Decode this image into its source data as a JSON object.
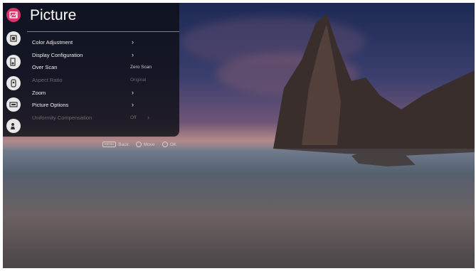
{
  "menu": {
    "title": "Picture",
    "items": [
      {
        "label": "Color Adjustment",
        "value": "",
        "chevron": "›",
        "enabled": true
      },
      {
        "label": "Display Configuration",
        "value": "",
        "chevron": "›",
        "enabled": true
      },
      {
        "label": "Over Scan",
        "value": "Zero Scan",
        "chevron": "",
        "enabled": true
      },
      {
        "label": "Aspect Ratio",
        "value": "Original",
        "chevron": "",
        "enabled": false
      },
      {
        "label": "Zoom",
        "value": "",
        "chevron": "›",
        "enabled": true
      },
      {
        "label": "Picture Options",
        "value": "",
        "chevron": "›",
        "enabled": true
      },
      {
        "label": "Uniformity Compensation",
        "value": "Off",
        "chevron": "›",
        "enabled": false
      }
    ]
  },
  "sidebar": {
    "icons": [
      "picture-icon",
      "display-icon",
      "sound-icon",
      "network-icon",
      "keyboard-icon",
      "admin-icon"
    ],
    "active_color": "#d8336a"
  },
  "footer": {
    "back_key": "MENU",
    "back_label": "Back",
    "move_label": "Move",
    "ok_label": "OK"
  }
}
